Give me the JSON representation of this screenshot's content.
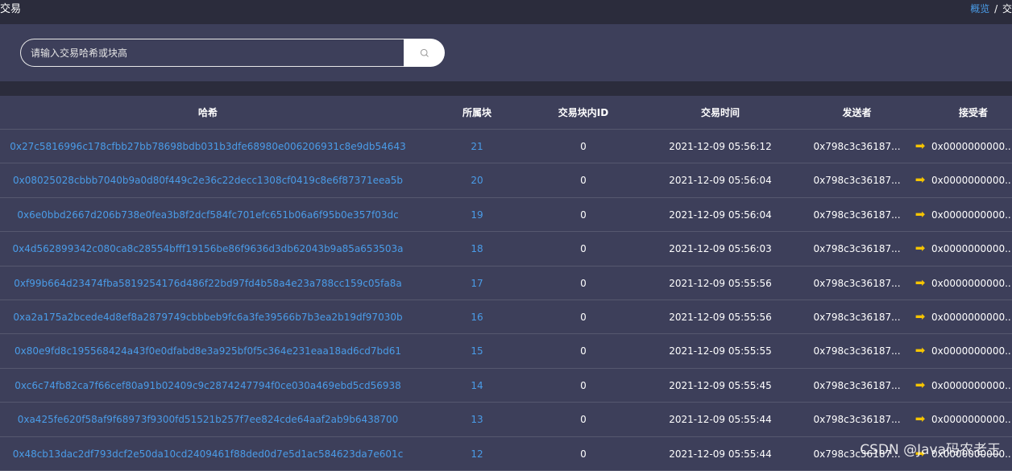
{
  "header": {
    "title": "交易",
    "breadcrumb_link": "概览",
    "breadcrumb_sep": "/",
    "breadcrumb_current": "交"
  },
  "search": {
    "placeholder": "请输入交易哈希或块高",
    "value": "",
    "button_icon": "search-icon"
  },
  "table": {
    "columns": [
      "哈希",
      "所属块",
      "交易块内ID",
      "交易时间",
      "发送者",
      "接受者"
    ],
    "arrow_icon": "arrow-right-icon",
    "rows": [
      {
        "hash": "0x27c5816996c178cfbb27bb78698bdb031b3dfe68980e006206931c8e9db54643",
        "block": "21",
        "index": "0",
        "time": "2021-12-09 05:56:12",
        "from": "0x798c3c36187...",
        "to": "0x0000000000..."
      },
      {
        "hash": "0x08025028cbbb7040b9a0d80f449c2e36c22decc1308cf0419c8e6f87371eea5b",
        "block": "20",
        "index": "0",
        "time": "2021-12-09 05:56:04",
        "from": "0x798c3c36187...",
        "to": "0x0000000000..."
      },
      {
        "hash": "0x6e0bbd2667d206b738e0fea3b8f2dcf584fc701efc651b06a6f95b0e357f03dc",
        "block": "19",
        "index": "0",
        "time": "2021-12-09 05:56:04",
        "from": "0x798c3c36187...",
        "to": "0x0000000000..."
      },
      {
        "hash": "0x4d562899342c080ca8c28554bfff19156be86f9636d3db62043b9a85a653503a",
        "block": "18",
        "index": "0",
        "time": "2021-12-09 05:56:03",
        "from": "0x798c3c36187...",
        "to": "0x0000000000..."
      },
      {
        "hash": "0xf99b664d23474fba5819254176d486f22bd97fd4b58a4e23a788cc159c05fa8a",
        "block": "17",
        "index": "0",
        "time": "2021-12-09 05:55:56",
        "from": "0x798c3c36187...",
        "to": "0x0000000000..."
      },
      {
        "hash": "0xa2a175a2bcede4d8ef8a2879749cbbbeb9fc6a3fe39566b7b3ea2b19df97030b",
        "block": "16",
        "index": "0",
        "time": "2021-12-09 05:55:56",
        "from": "0x798c3c36187...",
        "to": "0x0000000000..."
      },
      {
        "hash": "0x80e9fd8c195568424a43f0e0dfabd8e3a925bf0f5c364e231eaa18ad6cd7bd61",
        "block": "15",
        "index": "0",
        "time": "2021-12-09 05:55:55",
        "from": "0x798c3c36187...",
        "to": "0x0000000000..."
      },
      {
        "hash": "0xc6c74fb82ca7f66cef80a91b02409c9c2874247794f0ce030a469ebd5cd56938",
        "block": "14",
        "index": "0",
        "time": "2021-12-09 05:55:45",
        "from": "0x798c3c36187...",
        "to": "0x0000000000..."
      },
      {
        "hash": "0xa425fe620f58af9f68973f9300fd51521b257f7ee824cde64aaf2ab9b6438700",
        "block": "13",
        "index": "0",
        "time": "2021-12-09 05:55:44",
        "from": "0x798c3c36187...",
        "to": "0x0000000000..."
      },
      {
        "hash": "0x48cb13dac2df793dcf2e50da10cd2409461f88ded0d7e5d1ac584623da7e601c",
        "block": "12",
        "index": "0",
        "time": "2021-12-09 05:55:44",
        "from": "0x798c3c36187...",
        "to": "0x0000000000..."
      }
    ]
  },
  "watermark": "CSDN @Java码农老王",
  "colors": {
    "background": "#3d3f5a",
    "topbar": "#2b2c3c",
    "link": "#4a9ce8",
    "arrow": "#f5c400"
  }
}
